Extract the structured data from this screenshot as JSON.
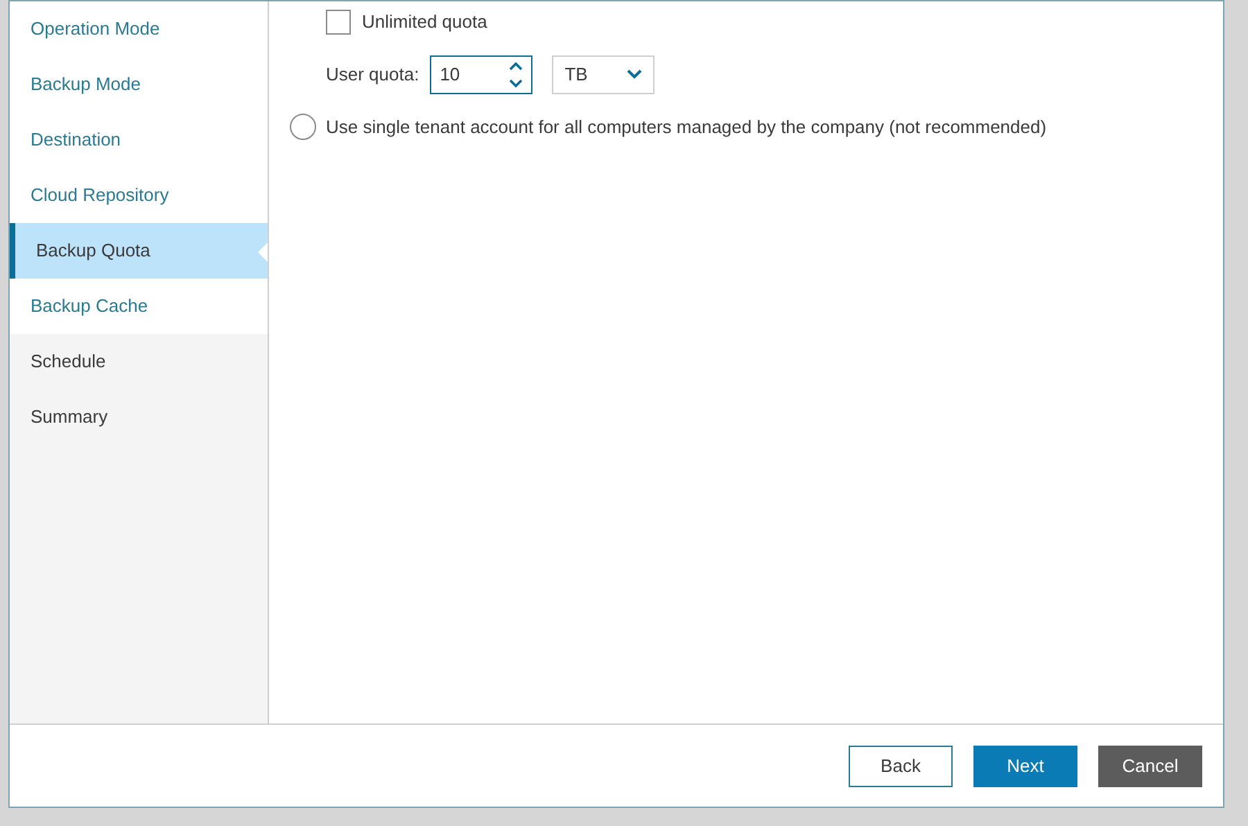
{
  "sidebar": {
    "items": [
      {
        "label": "Operation Mode",
        "visited": true,
        "selected": false
      },
      {
        "label": "Backup Mode",
        "visited": true,
        "selected": false
      },
      {
        "label": "Destination",
        "visited": true,
        "selected": false
      },
      {
        "label": "Cloud Repository",
        "visited": true,
        "selected": false
      },
      {
        "label": "Backup Quota",
        "selected": true
      },
      {
        "label": "Backup Cache",
        "visited": true,
        "selected": false
      },
      {
        "label": "Schedule",
        "visited": false,
        "selected": false
      },
      {
        "label": "Summary",
        "visited": false,
        "selected": false
      }
    ]
  },
  "quota": {
    "unlimited": {
      "label": "Unlimited quota",
      "checked": false
    },
    "user_quota": {
      "label": "User quota:",
      "value": "10"
    },
    "unit": {
      "value": "TB"
    }
  },
  "single_tenant": {
    "label": "Use single tenant account for all computers managed by the company (not recommended)",
    "selected": false
  },
  "buttons": [
    {
      "label": "Back",
      "kind": "secondary"
    },
    {
      "label": "Next",
      "kind": "primary"
    },
    {
      "label": "Cancel",
      "kind": "dark"
    }
  ]
}
